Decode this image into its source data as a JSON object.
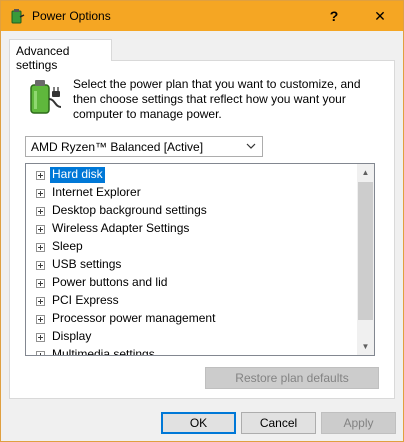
{
  "window": {
    "title": "Power Options",
    "help_glyph": "?",
    "close_glyph": "✕"
  },
  "tab": {
    "label": "Advanced settings"
  },
  "description": "Select the power plan that you want to customize, and then choose settings that reflect how you want your computer to manage power.",
  "plan_select": {
    "value": "AMD Ryzen™ Balanced [Active]"
  },
  "tree": {
    "items": [
      {
        "label": "Hard disk",
        "selected": true
      },
      {
        "label": "Internet Explorer"
      },
      {
        "label": "Desktop background settings"
      },
      {
        "label": "Wireless Adapter Settings"
      },
      {
        "label": "Sleep"
      },
      {
        "label": "USB settings"
      },
      {
        "label": "Power buttons and lid"
      },
      {
        "label": "PCI Express"
      },
      {
        "label": "Processor power management"
      },
      {
        "label": "Display"
      },
      {
        "label": "Multimedia settings"
      }
    ]
  },
  "buttons": {
    "restore": "Restore plan defaults",
    "ok": "OK",
    "cancel": "Cancel",
    "apply": "Apply"
  },
  "colors": {
    "titlebar": "#f5a623",
    "selection": "#0078d7"
  },
  "icons": {
    "app": "power-options-icon",
    "battery": "battery-plug-icon"
  }
}
